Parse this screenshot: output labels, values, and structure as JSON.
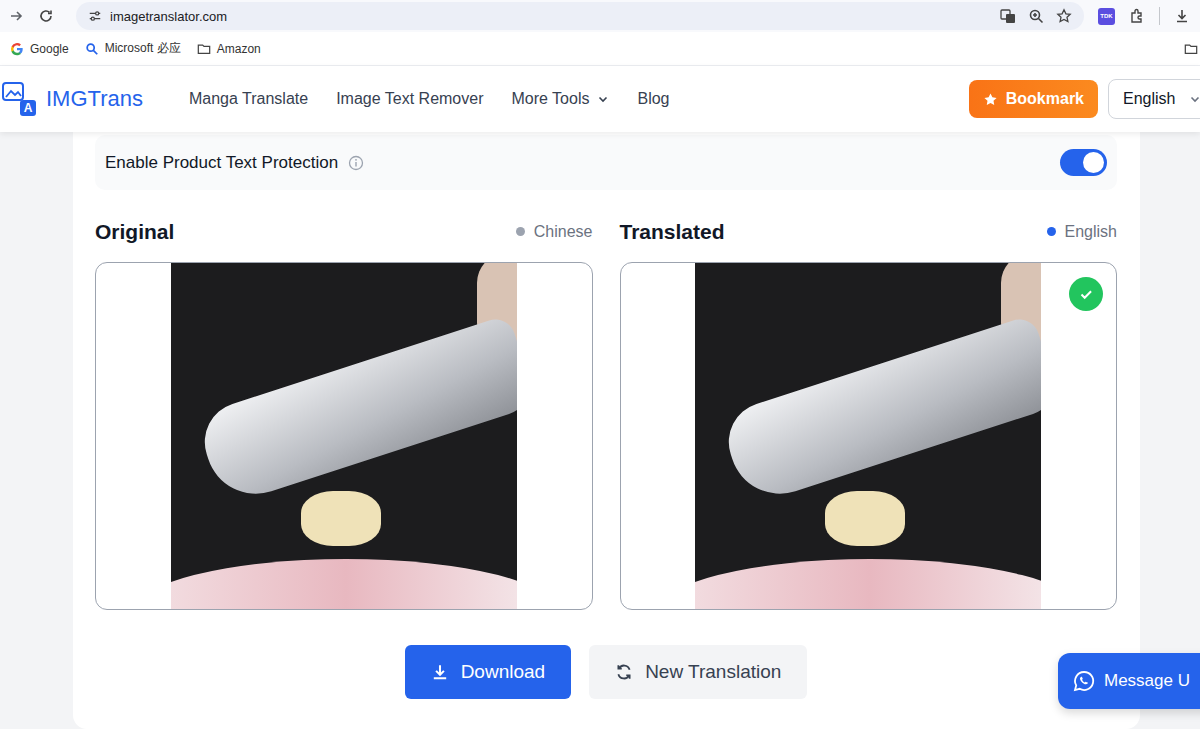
{
  "browser": {
    "url": "imagetranslator.com",
    "extension": "TDK",
    "bookmarks": [
      {
        "label": "Google"
      },
      {
        "label": "Microsoft 必应"
      },
      {
        "label": "Amazon"
      }
    ]
  },
  "header": {
    "logo": "IMGTrans",
    "logo_mark": "A",
    "nav": [
      {
        "label": "Manga Translate",
        "dropdown": false
      },
      {
        "label": "Image Text Remover",
        "dropdown": false
      },
      {
        "label": "More Tools",
        "dropdown": true
      },
      {
        "label": "Blog",
        "dropdown": false
      }
    ],
    "bookmark_button": "Bookmark",
    "language": "English"
  },
  "protection": {
    "label": "Enable Product Text Protection",
    "on": true
  },
  "panels": [
    {
      "title": "Original",
      "language": "Chinese",
      "color": "#9ca3af",
      "done": false
    },
    {
      "title": "Translated",
      "language": "English",
      "color": "#2563eb",
      "done": true
    }
  ],
  "actions": [
    {
      "label": "Download",
      "kind": "primary"
    },
    {
      "label": "New Translation",
      "kind": "secondary"
    }
  ],
  "chat": {
    "label": "Message U"
  }
}
